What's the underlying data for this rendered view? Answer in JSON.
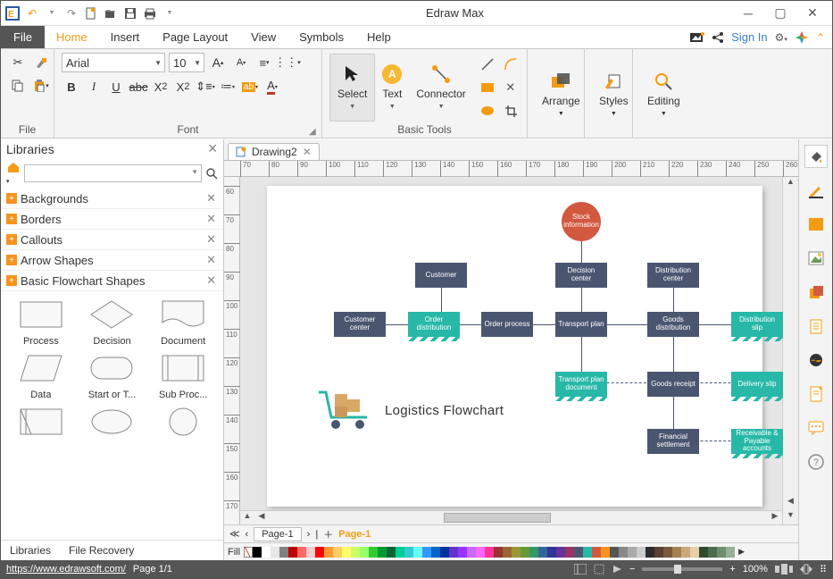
{
  "app": {
    "title": "Edraw Max"
  },
  "qat_icons": [
    "app-logo",
    "undo",
    "redo",
    "new",
    "open",
    "save",
    "print"
  ],
  "menus": {
    "file": "File",
    "home": "Home",
    "insert": "Insert",
    "page_layout": "Page Layout",
    "view": "View",
    "symbols": "Symbols",
    "help": "Help"
  },
  "topright": {
    "signin": "Sign In"
  },
  "ribbon": {
    "file_group": "File",
    "font_group": "Font",
    "font_name": "Arial",
    "font_size": "10",
    "basic_tools": "Basic Tools",
    "select": "Select",
    "text": "Text",
    "connector": "Connector",
    "arrange": "Arrange",
    "styles": "Styles",
    "editing": "Editing"
  },
  "libraries": {
    "title": "Libraries",
    "cats": [
      "Backgrounds",
      "Borders",
      "Callouts",
      "Arrow Shapes",
      "Basic Flowchart Shapes"
    ],
    "shapes": [
      "Process",
      "Decision",
      "Document",
      "Data",
      "Start or T...",
      "Sub Proc..."
    ],
    "tabs": {
      "libraries": "Libraries",
      "recovery": "File Recovery"
    }
  },
  "doc": {
    "tab": "Drawing2"
  },
  "ruler_h_start": 70,
  "ruler_v_start": 60,
  "flow": {
    "title": "Logistics Flowchart",
    "nodes": {
      "stock": "Stock information",
      "customer": "Customer",
      "decision_center": "Decision center",
      "distribution_center": "Distribution center",
      "customer_center": "Customer center",
      "order_distribution": "Order distribution",
      "order_process": "Order process",
      "transport_plan": "Transport plan",
      "goods_distribution": "Goods distribution",
      "distribution_slip": "Distribution slip",
      "transport_plan_doc": "Transport plan document",
      "goods_receipt": "Goods receipt",
      "delivery_slip": "Delivery slip",
      "financial_settlement": "Financial settlement",
      "receivable": "Receivable & Payable accounts"
    }
  },
  "page_tabs": {
    "page1": "Page-1",
    "page1b": "Page-1"
  },
  "colorbar_label": "Fill",
  "status": {
    "url": "https://www.edrawsoft.com/",
    "page": "Page 1/1",
    "zoom": "100%"
  },
  "colors": [
    "#000000",
    "#ffffff",
    "#e6e6e6",
    "#808080",
    "#c00000",
    "#ff6666",
    "#ffcccc",
    "#ff0000",
    "#ff9933",
    "#ffcc66",
    "#ffff66",
    "#ccff66",
    "#99ff66",
    "#33cc33",
    "#009933",
    "#006633",
    "#00cc99",
    "#33cccc",
    "#66ffff",
    "#3399ff",
    "#0066cc",
    "#003399",
    "#6633cc",
    "#9933ff",
    "#cc66ff",
    "#ff66ff",
    "#ff3399",
    "#993333",
    "#996633",
    "#999933",
    "#669933",
    "#339966",
    "#336699",
    "#333399",
    "#663399",
    "#993366",
    "#4a5670",
    "#27b8a8",
    "#d2583f",
    "#f7931e",
    "#555555",
    "#888888",
    "#aaaaaa",
    "#cccccc",
    "#2d2d2d",
    "#5c4033",
    "#7b5a3e",
    "#a58055",
    "#c9a97a",
    "#e6d0aa",
    "#2e4d2e",
    "#4d6b4d",
    "#6f8e6f",
    "#94b194"
  ]
}
